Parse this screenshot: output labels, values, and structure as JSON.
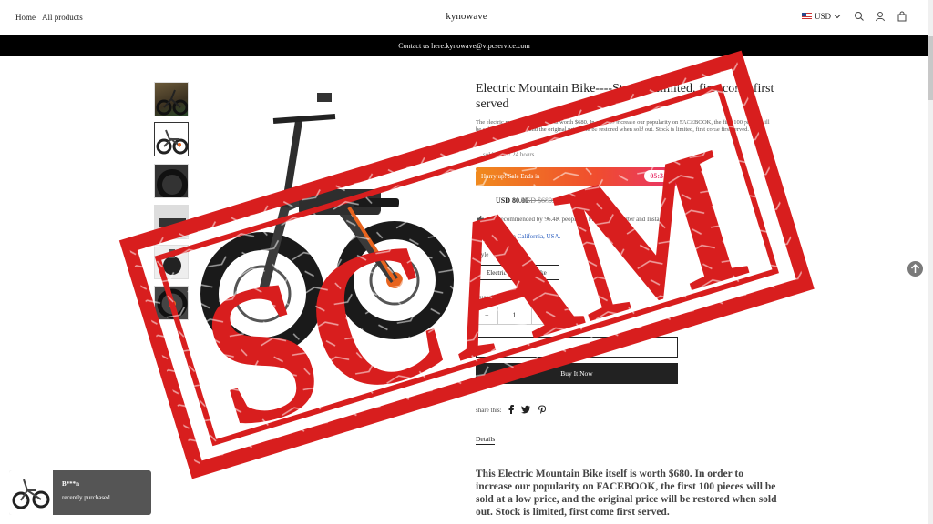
{
  "header": {
    "nav": [
      "Home",
      "All products"
    ],
    "brand": "kynowave",
    "currency": "USD",
    "icons": [
      "search-icon",
      "user-icon",
      "cart-icon"
    ]
  },
  "announcement": "Contact us here:kynowave@vipcservice.com",
  "product": {
    "title": "Electric Mountain Bike----Stock is limited, first come first served",
    "short_desc": "The electric mountain bike itself is worth $680. In order to increase our popularity on FACEBOOK, the first 100 pieces will be sold at a low price, and the original price will be restored when sold out. Stock is limited, first come first served.",
    "sold_text": "sold in last 24 hours",
    "timer_label": "Hurry up! Sale Ends in",
    "timer_value": "05:3",
    "price": "USD 80.00",
    "price_old": "USD $680.00",
    "recommend": "Recommended by 96.4K people on Facebook, Twitter and Instagram",
    "ships_prefix": "Ships from",
    "ships_location": "California, USA.",
    "style_label": "Style",
    "style_value": "Electric Mountain Bike",
    "qty_label": "Quantity",
    "qty_minus": "−",
    "qty_value": "1",
    "qty_plus": "+",
    "buy_now": "Buy It Now",
    "share_label": "share this:",
    "details_tab": "Details",
    "long_desc": "This Electric Mountain Bike itself is worth $680.  In order to increase our popularity on FACEBOOK, the first 100 pieces will be sold at a low price, and the original price will be restored when sold out. Stock is limited, first come first served."
  },
  "popup": {
    "name": "B***n",
    "text": "recently purchased"
  },
  "stamp": {
    "text": "SCAM",
    "color": "#d81e1e"
  }
}
